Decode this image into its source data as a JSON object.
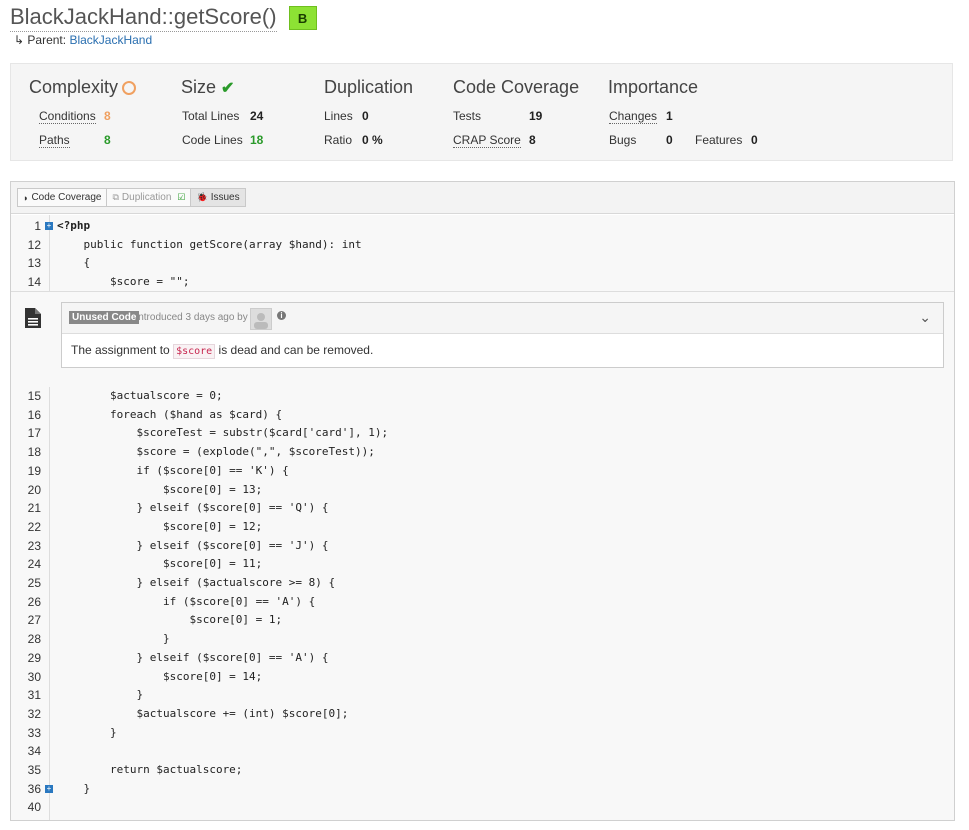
{
  "header": {
    "title": "BlackJackHand::getScore()",
    "grade": "B",
    "parent_prefix": "Parent:",
    "parent_link": "BlackJackHand"
  },
  "metrics": {
    "complexity": {
      "title": "Complexity",
      "conditions_label": "Conditions",
      "conditions_value": "8",
      "paths_label": "Paths",
      "paths_value": "8"
    },
    "size": {
      "title": "Size",
      "total_lines_label": "Total Lines",
      "total_lines_value": "24",
      "code_lines_label": "Code Lines",
      "code_lines_value": "18"
    },
    "duplication": {
      "title": "Duplication",
      "lines_label": "Lines",
      "lines_value": "0",
      "ratio_label": "Ratio",
      "ratio_value": "0 %"
    },
    "coverage": {
      "title": "Code Coverage",
      "tests_label": "Tests",
      "tests_value": "19",
      "crap_label": "CRAP Score",
      "crap_value": "8"
    },
    "importance": {
      "title": "Importance",
      "changes_label": "Changes",
      "changes_value": "1",
      "bugs_label": "Bugs",
      "bugs_value": "0",
      "features_label": "Features",
      "features_value": "0"
    }
  },
  "tabs": {
    "code_coverage": "Code Coverage",
    "duplication": "Duplication",
    "issues": "Issues"
  },
  "code_top": [
    {
      "n": "1",
      "code": "<?php",
      "expand": true,
      "bold": true
    },
    {
      "n": "12",
      "code": "    public function getScore(array $hand): int"
    },
    {
      "n": "13",
      "code": "    {"
    },
    {
      "n": "14",
      "code": "        $score = \"\";"
    }
  ],
  "issue": {
    "badge": "Unused Code",
    "introduced": "introduced 3 days ago by",
    "msg_before": "The assignment to",
    "msg_code": "$score",
    "msg_after": "is dead and can be removed."
  },
  "code_bottom": [
    {
      "n": "15",
      "code": "        $actualscore = 0;"
    },
    {
      "n": "16",
      "code": "        foreach ($hand as $card) {"
    },
    {
      "n": "17",
      "code": "            $scoreTest = substr($card['card'], 1);"
    },
    {
      "n": "18",
      "code": "            $score = (explode(\",\", $scoreTest));"
    },
    {
      "n": "19",
      "code": "            if ($score[0] == 'K') {"
    },
    {
      "n": "20",
      "code": "                $score[0] = 13;"
    },
    {
      "n": "21",
      "code": "            } elseif ($score[0] == 'Q') {"
    },
    {
      "n": "22",
      "code": "                $score[0] = 12;"
    },
    {
      "n": "23",
      "code": "            } elseif ($score[0] == 'J') {"
    },
    {
      "n": "24",
      "code": "                $score[0] = 11;"
    },
    {
      "n": "25",
      "code": "            } elseif ($actualscore >= 8) {"
    },
    {
      "n": "26",
      "code": "                if ($score[0] == 'A') {"
    },
    {
      "n": "27",
      "code": "                    $score[0] = 1;"
    },
    {
      "n": "28",
      "code": "                }"
    },
    {
      "n": "29",
      "code": "            } elseif ($score[0] == 'A') {"
    },
    {
      "n": "30",
      "code": "                $score[0] = 14;"
    },
    {
      "n": "31",
      "code": "            }"
    },
    {
      "n": "32",
      "code": "            $actualscore += (int) $score[0];"
    },
    {
      "n": "33",
      "code": "        }"
    },
    {
      "n": "34",
      "code": ""
    },
    {
      "n": "35",
      "code": "        return $actualscore;"
    },
    {
      "n": "36",
      "code": "    }",
      "expand": true
    },
    {
      "n": "40",
      "code": ""
    }
  ]
}
